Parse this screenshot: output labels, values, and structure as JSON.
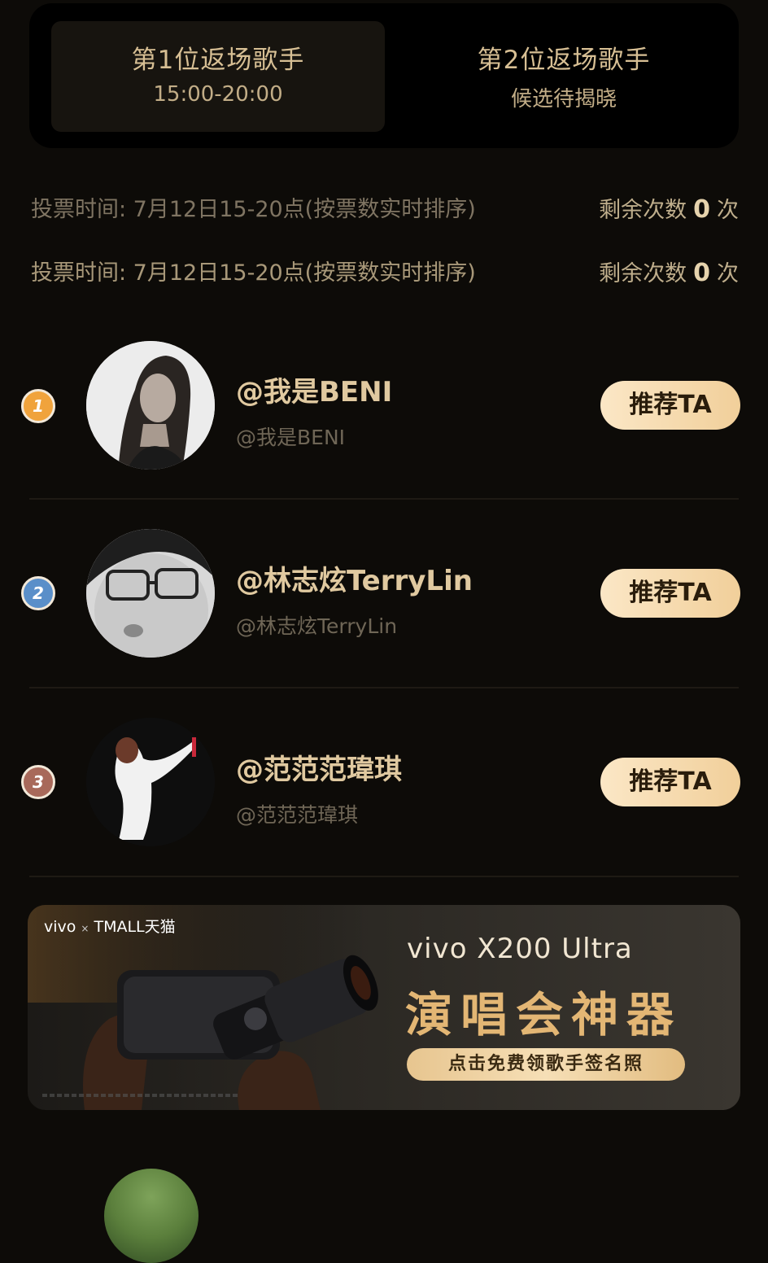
{
  "tabs": [
    {
      "title": "第1位返场歌手",
      "subtitle": "15:00-20:00",
      "active": true
    },
    {
      "title": "第2位返场歌手",
      "subtitle": "候选待揭晓",
      "active": false
    }
  ],
  "vote_info": [
    {
      "time_text": "投票时间: 7月12日15-20点(按票数实时排序)",
      "remaining_label": "剩余次数",
      "remaining_count": "0",
      "unit": "次"
    },
    {
      "time_text": "投票时间: 7月12日15-20点(按票数实时排序)",
      "remaining_label": "剩余次数",
      "remaining_count": "0",
      "unit": "次"
    }
  ],
  "singers": [
    {
      "rank": "1",
      "name": "@我是BENI",
      "handle": "@我是BENI",
      "button": "推荐TA",
      "badge_color": "#f0a33c"
    },
    {
      "rank": "2",
      "name": "@林志炫TerryLin",
      "handle": "@林志炫TerryLin",
      "button": "推荐TA",
      "badge_color": "#5a8fc9"
    },
    {
      "rank": "3",
      "name": "@范范范瑋琪",
      "handle": "@范范范瑋琪",
      "button": "推荐TA",
      "badge_color": "#a8695a"
    }
  ],
  "banner": {
    "brand_left": "vivo",
    "brand_sep": "×",
    "brand_right": "TMALL天猫",
    "model": "vivo X200 Ultra",
    "headline": "演唱会神器",
    "cta": "点击免费领歌手签名照"
  },
  "colors": {
    "background": "#0d0b08",
    "accent_gold": "#e0c9a0",
    "button_gradient_start": "#fbe7c6",
    "button_gradient_end": "#f1cf9a"
  }
}
